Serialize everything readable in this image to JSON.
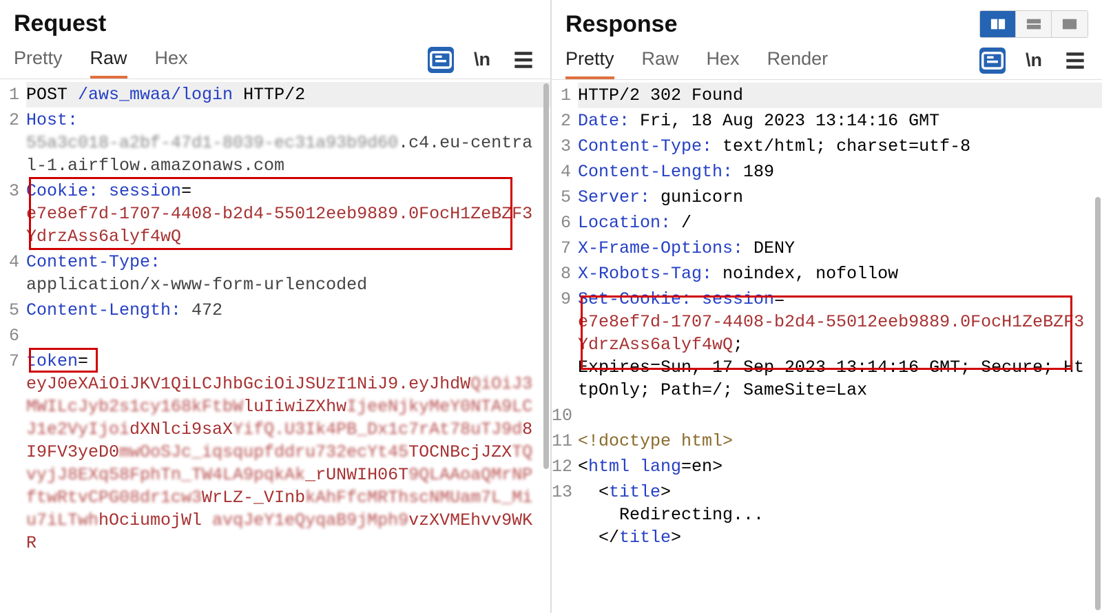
{
  "request": {
    "title": "Request",
    "tabs": {
      "pretty": "Pretty",
      "raw": "Raw",
      "hex": "Hex"
    },
    "active_tab": "raw",
    "lines": {
      "l1_method": "POST",
      "l1_path": " /aws_mwaa/login ",
      "l1_proto": "HTTP/2",
      "l2_header": "Host:",
      "l2_blur": "55a3c018-a2bf-47d1-8039-ec31a93b9d60",
      "l2_rest": ".c4.eu-central-1.airflow.amazonaws.com",
      "l3_header": "Cookie: ",
      "l3_key": "session",
      "l3_eq": "=",
      "l3_val": "e7e8ef7d-1707-4408-b2d4-55012eeb9889.0FocH1ZeBZF3YdrzAss6alyf4wQ",
      "l4_header": "Content-Type:",
      "l4_val": "application/x-www-form-urlencoded",
      "l5_header": "Content-Length:",
      "l5_val": " 472",
      "l7_key": "token",
      "l7_eq": "=",
      "l7_body_a": "eyJ0eXAiOiJKV1QiLCJhbGciOiJSUzI1NiJ9.eyJhdW",
      "l7_blur1": "QiOiJ3MWILcJyb2s1cy168kFtbW",
      "l7_body_b": "luIiwiZXhw",
      "l7_blur2": "IjeeNjkyMeY0NTA9LCJ1e2VyIjoi",
      "l7_body_c": "dXNlci9saX",
      "l7_blur3": "YifQ.U3Ik4PB_Dx1c7rAt78uTJ9d",
      "l7_body_d": "8I9FV3yeD0",
      "l7_blur4": "mwOoSJc_iqsqupfddru732ecYt45",
      "l7_body_e": "TOCNBcjJZX",
      "l7_blur5": "TQvyjJ8EXq58FphTn_TW4LA9pqkAk",
      "l7_body_f": "_rUNWIH06T",
      "l7_blur6": "9QLAAoaQMrNPftwRtvCPG08dr1cw3",
      "l7_body_g": "WrLZ-_VInb",
      "l7_blur7": "kAhFfcMRThscNMUam7L_Miu7iLTwh",
      "l7_body_h": "hOciumojWl",
      "l7_blur8": " avqJeY1eQyqaB9jMph9",
      "l7_body_i": "vzXVMEhvv9WKR"
    }
  },
  "response": {
    "title": "Response",
    "tabs": {
      "pretty": "Pretty",
      "raw": "Raw",
      "hex": "Hex",
      "render": "Render"
    },
    "active_tab": "pretty",
    "lines": {
      "l1": "HTTP/2 302 Found",
      "l2_h": "Date:",
      "l2_v": " Fri, 18 Aug 2023 13:14:16 GMT",
      "l3_h": "Content-Type:",
      "l3_v": " text/html; charset=utf-8",
      "l4_h": "Content-Length:",
      "l4_v": " 189",
      "l5_h": "Server:",
      "l5_v": " gunicorn",
      "l6_h": "Location:",
      "l6_v": " /",
      "l7_h": "X-Frame-Options:",
      "l7_v": " DENY",
      "l8_h": "X-Robots-Tag:",
      "l8_v": " noindex, nofollow",
      "l9_h": "Set-Cookie: ",
      "l9_k": "session",
      "l9_eq": "=",
      "l9_val": "e7e8ef7d-1707-4408-b2d4-55012eeb9889.0FocH1ZeBZF3YdrzAss6alyf4wQ",
      "l9_semi": "; ",
      "l9_rest": "Expires=Sun, 17 Sep 2023 13:14:16 GMT; Secure; HttpOnly; Path=/; SameSite=Lax",
      "l11": "<!doctype html>",
      "l12_open": "<",
      "l12_tag": "html",
      "l12_attr": " lang",
      "l12_eq": "=en",
      "l12_close": ">",
      "l13_open": "<",
      "l13_tag": "title",
      "l13_close": ">",
      "l13_text": "Redirecting...",
      "l13c_open": "</",
      "l13c_tag": "title",
      "l13c_close": ">"
    }
  },
  "toolbar": {
    "wrap_label": "\\n"
  }
}
